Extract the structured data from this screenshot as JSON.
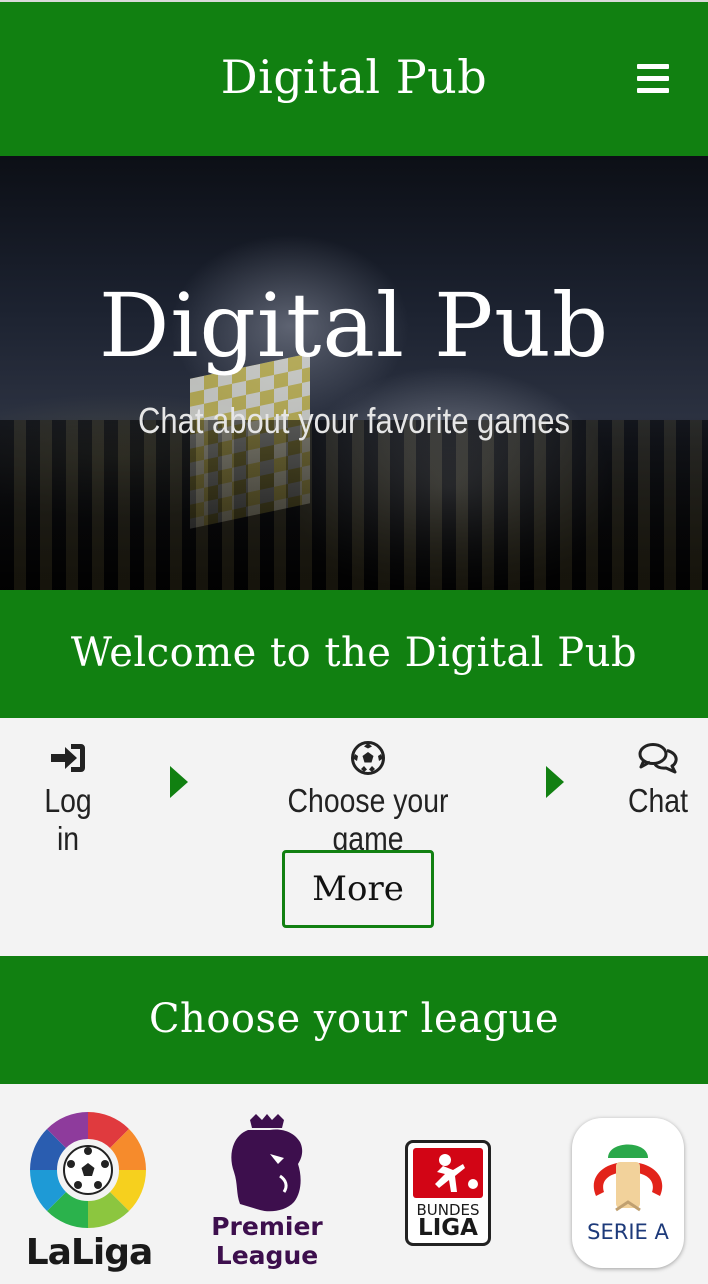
{
  "navbar": {
    "brand": "Digital Pub",
    "menu_icon": "hamburger-menu-icon",
    "color": "#118011"
  },
  "hero": {
    "title": "Digital Pub",
    "subtitle": "Chat about your favorite games"
  },
  "welcome": {
    "heading": "Welcome to the Digital Pub",
    "steps": [
      {
        "label": "Log in",
        "icon": "sign-in-icon"
      },
      {
        "label": "Choose your game",
        "icon": "soccer-ball-icon"
      },
      {
        "label": "Chat",
        "icon": "chat-bubbles-icon"
      }
    ],
    "more_label": "More"
  },
  "leagues": {
    "heading": "Choose your league",
    "items": [
      {
        "name": "LaLiga",
        "logo_text": "LaLiga"
      },
      {
        "name": "Premier League",
        "logo_text": [
          "Premier",
          "League"
        ]
      },
      {
        "name": "Bundesliga",
        "logo_text": [
          "BUNDES",
          "LIGA"
        ]
      },
      {
        "name": "Serie A",
        "logo_text": "SERIE A"
      }
    ]
  }
}
